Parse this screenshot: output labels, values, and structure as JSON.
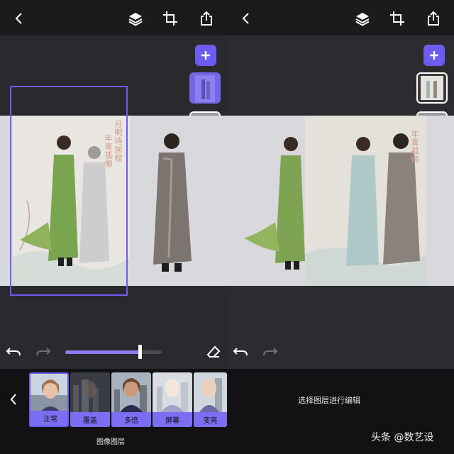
{
  "left": {
    "toolbar": {
      "back": "back-icon",
      "layers": "layers-icon",
      "crop": "crop-icon",
      "share": "share-icon"
    },
    "poster_text": {
      "title_a": "月明待前程",
      "title_b": "年青孤懒"
    }
  },
  "right": {
    "toolbar": {
      "back": "back-icon",
      "layers": "layers-icon",
      "crop": "crop-icon",
      "share": "share-icon"
    },
    "poster_text": {
      "title_a": "年青孤懒"
    },
    "hint": "选择图层进行编辑"
  },
  "slider": {
    "value": 0.77
  },
  "blend_modes": [
    {
      "label": "正常",
      "selected": true
    },
    {
      "label": "覆盖",
      "selected": false
    },
    {
      "label": "多倍",
      "selected": false
    },
    {
      "label": "屏幕",
      "selected": false
    },
    {
      "label": "变亮",
      "selected": false
    }
  ],
  "bottom_label": "图像图层",
  "watermark": {
    "brand": "头条",
    "handle": "@数艺设"
  },
  "colors": {
    "accent": "#6d5cf0",
    "label_bg": "#7b6ef3"
  }
}
